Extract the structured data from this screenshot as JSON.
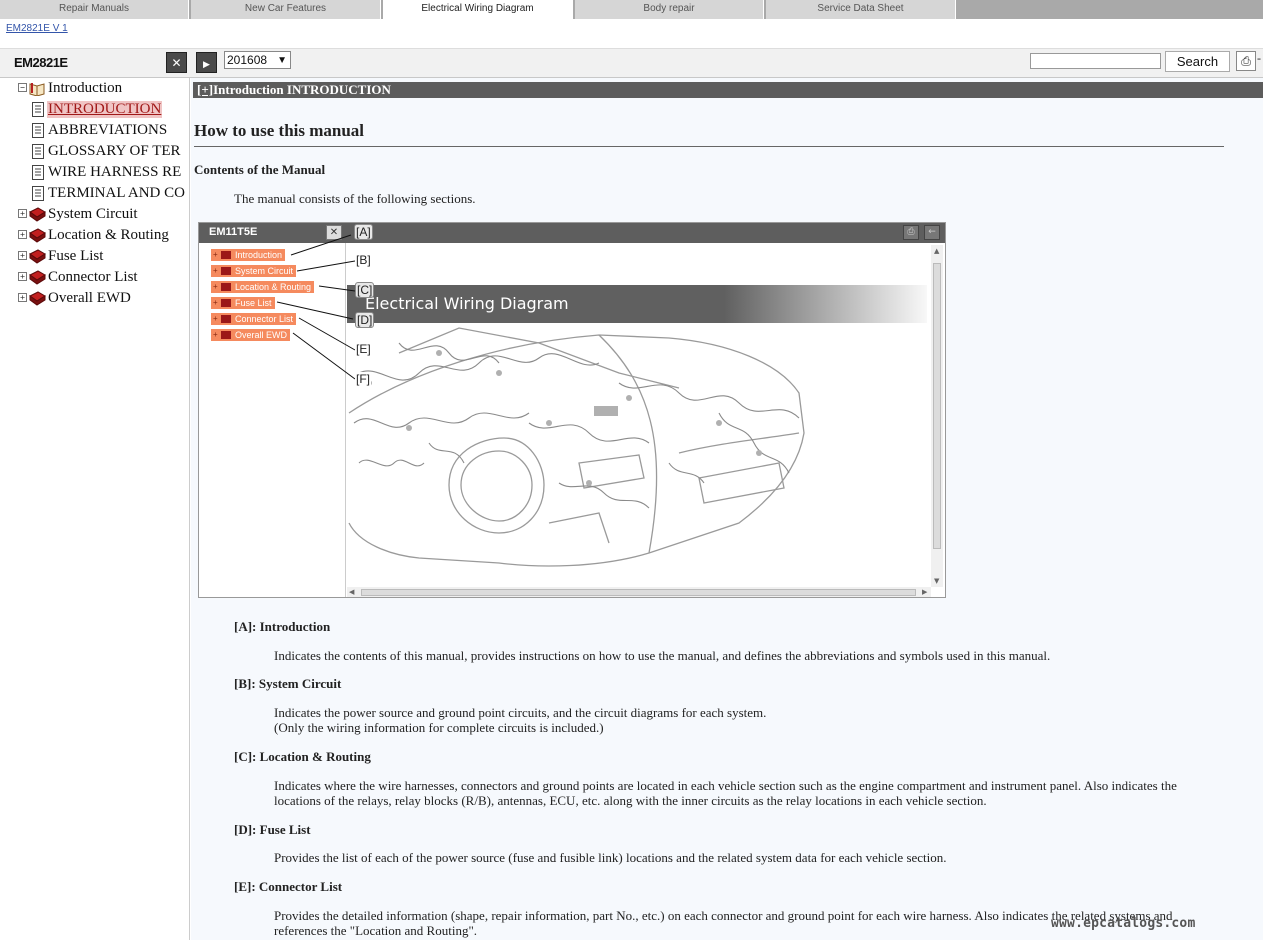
{
  "tabs": [
    {
      "label": "Repair Manuals",
      "active": false
    },
    {
      "label": "New Car Features",
      "active": false
    },
    {
      "label": "Electrical Wiring Diagram",
      "active": true
    },
    {
      "label": "Body repair",
      "active": false
    },
    {
      "label": "Service Data Sheet",
      "active": false
    }
  ],
  "version_link": "EM2821E V 1",
  "toolbar": {
    "doc_id": "EM2821E",
    "close_icon": "close-icon",
    "play_icon": "play-icon",
    "version_value": "201608",
    "search_value": "",
    "search_label": "Search",
    "print_icon": "printer-icon"
  },
  "tree": [
    {
      "label": "Introduction",
      "icon": "open-book-icon",
      "expander": "−"
    },
    {
      "label": "INTRODUCTION",
      "icon": "document-icon",
      "selected": true
    },
    {
      "label": "ABBREVIATIONS",
      "icon": "document-icon"
    },
    {
      "label": "GLOSSARY OF TER",
      "icon": "document-icon"
    },
    {
      "label": "WIRE HARNESS RE",
      "icon": "document-icon"
    },
    {
      "label": "TERMINAL AND CO",
      "icon": "document-icon"
    },
    {
      "label": "System Circuit",
      "icon": "book-icon",
      "expander": "+"
    },
    {
      "label": "Location & Routing",
      "icon": "book-icon",
      "expander": "+"
    },
    {
      "label": "Fuse List",
      "icon": "book-icon",
      "expander": "+"
    },
    {
      "label": "Connector List",
      "icon": "book-icon",
      "expander": "+"
    },
    {
      "label": "Overall EWD",
      "icon": "book-icon",
      "expander": "+"
    }
  ],
  "content": {
    "breadcrumb_plus": "[+]",
    "breadcrumb_text": "Introduction  INTRODUCTION",
    "title": "How to use this manual",
    "subtitle": "Contents of the Manual",
    "intro": "The manual consists of the following sections.",
    "figure": {
      "id": "EM11T5E",
      "items": [
        "Introduction",
        "System Circuit",
        "Location & Routing",
        "Fuse List",
        "Connector List",
        "Overall EWD"
      ],
      "labels": [
        "[A]",
        "[B]",
        "[C]",
        "[D]",
        "[E]",
        "[F]"
      ],
      "banner": "Electrical Wiring Diagram"
    },
    "sections": [
      {
        "heading": "[A]: Introduction",
        "lines": [
          "Indicates the contents of this manual, provides instructions on how to use the manual, and defines the abbreviations and symbols used in this manual."
        ]
      },
      {
        "heading": "[B]: System Circuit",
        "lines": [
          "Indicates the power source and ground point circuits, and the circuit diagrams for each system.",
          "(Only the wiring information for complete circuits is included.)"
        ]
      },
      {
        "heading": "[C]: Location & Routing",
        "lines": [
          "Indicates where the wire harnesses, connectors and ground points are located in each vehicle section such as the engine compartment and instrument panel. Also indicates the",
          "locations of the relays, relay blocks (R/B), antennas, ECU, etc. along with the inner circuits as the relay locations in each vehicle section."
        ]
      },
      {
        "heading": "[D]: Fuse List",
        "lines": [
          "Provides the list of each of the power source (fuse and fusible link) locations and the related system data for each vehicle section."
        ]
      },
      {
        "heading": "[E]: Connector List",
        "lines": [
          "Provides the detailed information (shape, repair information, part No., etc.) on each connector and ground point for each wire harness. Also indicates the related systems and",
          "references the \"Location and Routing\"."
        ]
      }
    ]
  },
  "watermark": "www.epcatalogs.com"
}
